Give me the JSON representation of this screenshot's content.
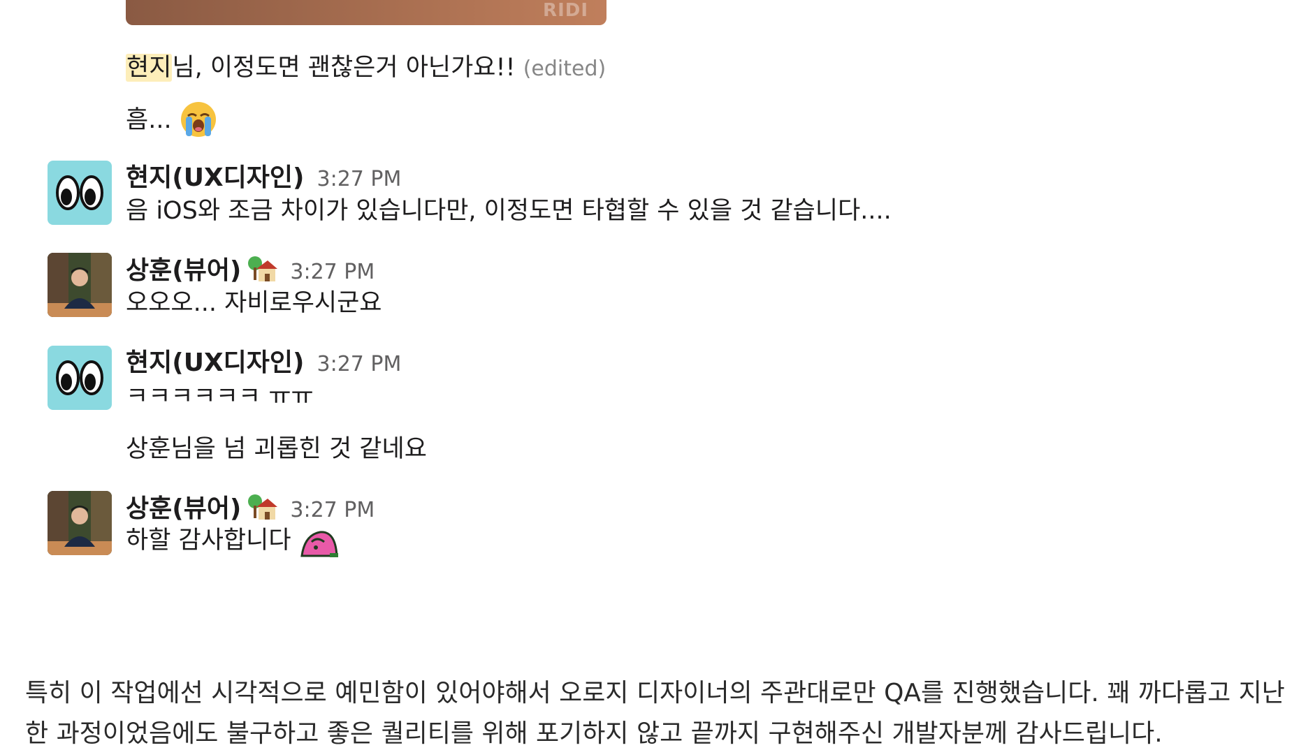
{
  "top_image": {
    "watermark": "RIDI"
  },
  "messages": {
    "m1": {
      "mention": "현지",
      "text": "님, 이정도면 괜찮은거 아닌가요!!",
      "edited": "(edited)"
    },
    "m2": {
      "text": "흠..."
    },
    "g1": {
      "sender": "현지(UX디자인)",
      "time": "3:27 PM",
      "text": "음 iOS와 조금 차이가 있습니다만, 이정도면 타협할 수 있을 것 같습니다...."
    },
    "g2": {
      "sender": "상훈(뷰어)",
      "status_icon": "house-with-tree-icon",
      "time": "3:27 PM",
      "text": "오오오... 자비로우시군요"
    },
    "g3": {
      "sender": "현지(UX디자인)",
      "time": "3:27 PM",
      "text1": "ㅋㅋㅋㅋㅋㅋ ㅠㅠ",
      "text2": "상훈님을 넘 괴롭힌 것 같네요"
    },
    "g4": {
      "sender": "상훈(뷰어)",
      "status_icon": "house-with-tree-icon",
      "time": "3:27 PM",
      "text": "하할 감사합니다"
    }
  },
  "article": {
    "paragraph": "특히 이 작업에선 시각적으로 예민함이 있어야해서 오로지 디자이너의 주관대로만 QA를 진행했습니다. 꽤 까다롭고 지난한 과정이었음에도 불구하고 좋은 퀄리티를 위해 포기하지 않고 끝까지 구현해주신 개발자분께 감사드립니다."
  }
}
